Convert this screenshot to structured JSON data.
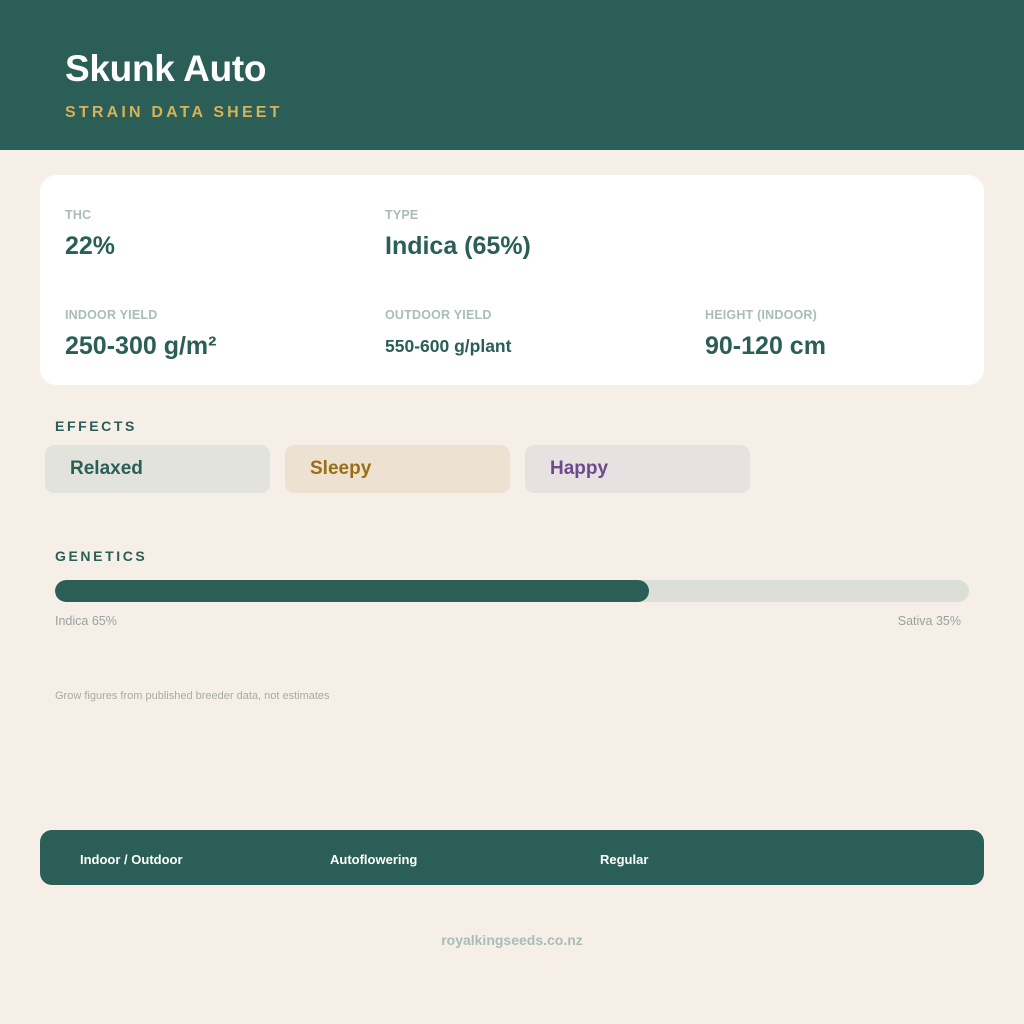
{
  "header": {
    "title": "Skunk Auto",
    "subtitle": "STRAIN DATA SHEET"
  },
  "stats": {
    "thc": {
      "label": "THC",
      "value": "22%"
    },
    "type": {
      "label": "TYPE",
      "value": "Indica (65%)"
    },
    "indoor_yield": {
      "label": "INDOOR YIELD",
      "value": "250-300 g/m²"
    },
    "outdoor_yield": {
      "label": "OUTDOOR YIELD",
      "value": "550-600 g/plant"
    },
    "height_indoor": {
      "label": "HEIGHT (INDOOR)",
      "value": "90-120 cm"
    }
  },
  "effects": {
    "heading": "EFFECTS",
    "items": [
      "Relaxed",
      "Sleepy",
      "Happy"
    ]
  },
  "genetics": {
    "heading": "GENETICS",
    "indica_percent": 65,
    "indica_label": "Indica 65%",
    "sativa_label": "Sativa 35%"
  },
  "note": "Grow figures from published breeder data, not estimates",
  "footer": {
    "items": [
      "Indoor / Outdoor",
      "Autoflowering",
      "Regular"
    ]
  },
  "site": "royalkingseeds.co.nz",
  "colors": {
    "primary": "#2a5e56",
    "accent": "#d6b25a",
    "background": "#f5efe8"
  }
}
